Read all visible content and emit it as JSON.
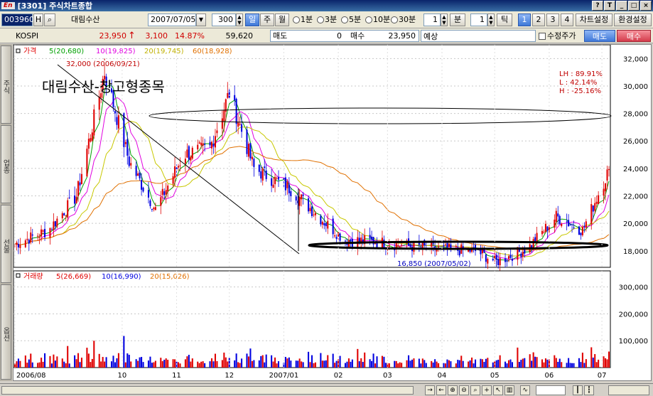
{
  "window": {
    "code": "[3301]",
    "title": "주식차트종합",
    "logo": "En"
  },
  "toolbar": {
    "stock_code": "003960",
    "stock_name": "대림수산",
    "date": "2007/07/05",
    "count": "300",
    "period_tabs": [
      "일",
      "주",
      "월"
    ],
    "intervals": [
      "1분",
      "3분",
      "5분",
      "10분",
      "30분"
    ],
    "min_value": "1",
    "min_label": "분",
    "tick_value": "1",
    "tick_label": "틱",
    "pages": [
      "1",
      "2",
      "3",
      "4"
    ],
    "chart_settings": "차트설정",
    "env_settings": "환경설정"
  },
  "infobar": {
    "index": "KOSPI",
    "price": "23,950",
    "change": "3,100",
    "change_pct": "14.87%",
    "volume": "59,620",
    "sell_label": "매도",
    "sell_value": "0",
    "buy_label": "매수",
    "buy_value": "23,950",
    "forecast_label": "예상",
    "adjusted_label": "수정주가",
    "sell_button": "매도",
    "buy_button": "매수"
  },
  "side_tabs": [
    "주식",
    "업종",
    "선물",
    "옵션"
  ],
  "price_legend": {
    "price": "가격",
    "ma5": "5(20,680)",
    "ma10": "10(19,825)",
    "ma20": "20(19,745)",
    "ma60": "60(18,928)"
  },
  "volume_legend": {
    "volume": "거래량",
    "ma5": "5(26,669)",
    "ma10": "10(16,990)",
    "ma20": "20(15,026)"
  },
  "annotations": {
    "stock_title": "대림수산-창고형종목",
    "high_marker": "32,000 (2006/09/21)",
    "low_marker": "16,850 (2007/05/02)",
    "lh": "LH : 89.91%",
    "l": "L  : 42.14%",
    "h": "H  : -25.16%"
  },
  "colors": {
    "up": "#e00000",
    "down": "#0000e0",
    "ma5": "#00a000",
    "ma10": "#e000e0",
    "ma20": "#c8c800",
    "ma60": "#e07000",
    "accent": "#3f78d8"
  },
  "chart_data": [
    {
      "type": "candlestick",
      "title": "",
      "y_ticks": [
        18000,
        20000,
        22000,
        24000,
        26000,
        28000,
        30000,
        32000
      ],
      "y_tick_labels": [
        "18,000",
        "20,000",
        "22,000",
        "24,000",
        "26,000",
        "28,000",
        "30,000",
        "32,000"
      ],
      "ylim": [
        16800,
        33000
      ],
      "x_tick_labels": [
        "2006/08",
        "10",
        "11",
        "12",
        "2007/01",
        "02",
        "03",
        "04",
        "05",
        "06",
        "07"
      ],
      "key_points": [
        {
          "date": "2006/09/21",
          "label": "high",
          "value": 32000
        },
        {
          "date": "2007/05/02",
          "label": "low",
          "value": 16850
        },
        {
          "date": "2007/07/05",
          "label": "close",
          "value": 23950
        }
      ],
      "close_path": [
        [
          "2006/08/01",
          18500
        ],
        [
          "2006/08/20",
          19500
        ],
        [
          "2006/09/05",
          22000
        ],
        [
          "2006/09/21",
          31000
        ],
        [
          "2006/10/05",
          24500
        ],
        [
          "2006/10/20",
          21000
        ],
        [
          "2006/11/05",
          25000
        ],
        [
          "2006/11/20",
          25500
        ],
        [
          "2006/12/01",
          29500
        ],
        [
          "2006/12/15",
          24000
        ],
        [
          "2007/01/05",
          22500
        ],
        [
          "2007/01/25",
          20000
        ],
        [
          "2007/02/05",
          18800
        ],
        [
          "2007/02/20",
          18700
        ],
        [
          "2007/03/10",
          18400
        ],
        [
          "2007/04/01",
          18100
        ],
        [
          "2007/04/20",
          18000
        ],
        [
          "2007/05/02",
          17200
        ],
        [
          "2007/05/20",
          18200
        ],
        [
          "2007/06/05",
          20500
        ],
        [
          "2007/06/20",
          19500
        ],
        [
          "2007/07/05",
          23950
        ]
      ]
    },
    {
      "type": "bar",
      "title": "",
      "y_ticks": [
        100000,
        200000,
        300000
      ],
      "y_tick_labels": [
        "100,000",
        "200,000",
        "300,000"
      ],
      "ylim": [
        0,
        360000
      ],
      "x_tick_labels": [
        "2006/08",
        "10",
        "11",
        "12",
        "2007/01",
        "02",
        "03",
        "04",
        "05",
        "06",
        "07"
      ],
      "last_volume": 59620
    }
  ]
}
